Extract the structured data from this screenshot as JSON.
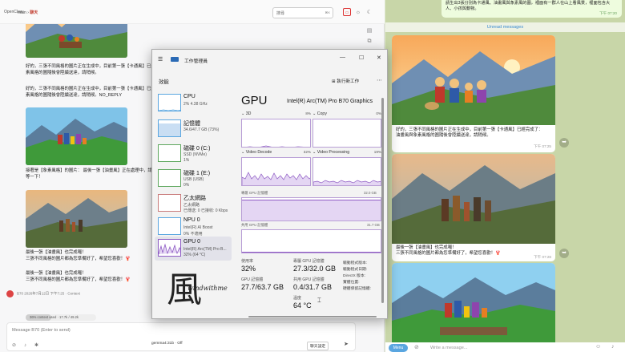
{
  "openclaw": {
    "brand": "OpenClaw",
    "breadcrumb": {
      "main": "main",
      "current": "聊天"
    },
    "search": {
      "placeholder": "搜尋",
      "shortcut": "⌘K"
    },
    "messages": [
      {
        "text": "好的，三張不同風格的圖片正在生成中，目前第一張【卡通風】已生成，油畫風與象素風格的圖隨後會陸續送達，請稍候。"
      },
      {
        "text": "好的，三張不同風格的圖片正在生成中，目前第一張【卡通風】已生成，油畫風與象素風格的圖隨後會陸續送達，請稍候。NO_REPLY"
      },
      {
        "text": "接著是【象素風格】的圖片：\n最後一張【油畫風】正在處理中，請再稍等一下！"
      },
      {
        "text": "最後一張【油畫風】也完成囉！\n三張不同風格的圖片都為您準備好了，希望您喜歡！🦞"
      },
      {
        "text": "最後一張【油畫風】也完成囉！\n三張不同風格的圖片都為您準備好了，希望您喜歡！🦞"
      }
    ],
    "meta": {
      "author": "B70",
      "timestamp": "2026年7月12日 下午7:25",
      "context_label": "Context"
    },
    "context": {
      "label": "36% context used",
      "tokens": "17.7k / 49.2k",
      "fraction": 0.36
    },
    "composer": {
      "placeholder": "Message B70 (Enter to send)",
      "model": "gemma4:31b · Off",
      "voice": "聊天設定"
    }
  },
  "telegram": {
    "top_bubble": {
      "text": "請生出3張分別為卡通風、油畫風與象素風的圖，裡面有一群人在山上看風景，裡面包含大人、小孩與動物。",
      "time": "下午 07:20"
    },
    "unread": "Unread messages",
    "messages": [
      {
        "text": "好的，三張不同風格的圖片正在生成中，目前第一張【卡通風】已經完成了：\n油畫風與象素風格的圖隨後會陸續送達，請稍候。",
        "time": "下午 07:25"
      },
      {
        "text": "最後一張【油畫風】也完成囉！\n三張不同風格的圖片都為您準備好了，希望您喜歡！🦞",
        "time": "下午 07:28"
      }
    ],
    "input": {
      "menu": "Menu",
      "placeholder": "Write a message..."
    }
  },
  "taskmgr": {
    "title": "工作管理員",
    "section": "效能",
    "run_task": "執行新工作",
    "sidebar": [
      {
        "name": "CPU",
        "s1": "2% 4.38 GHz",
        "s2": ""
      },
      {
        "name": "記憶體",
        "s1": "34.6/47.7 GB (73%)",
        "s2": ""
      },
      {
        "name": "磁碟 0 (C:)",
        "s1": "SSD (NVMe)",
        "s2": "1%"
      },
      {
        "name": "磁碟 1 (E:)",
        "s1": "USB (USB)",
        "s2": "0%"
      },
      {
        "name": "乙太網路",
        "s1": "乙太網路",
        "s2": "已傳送: 0 已接收: 0 Kbps"
      },
      {
        "name": "NPU 0",
        "s1": "Intel(R) AI Boost",
        "s2": "0% 不適用"
      },
      {
        "name": "GPU 0",
        "s1": "Intel(R) Arc(TM) Pro B...",
        "s2": "32% (64 °C)"
      }
    ],
    "gpu": {
      "heading": "GPU",
      "name": "Intel(R) Arc(TM) Pro B70 Graphics",
      "graphs": [
        {
          "label": "3D",
          "pct": "8%"
        },
        {
          "label": "Copy",
          "pct": "0%"
        },
        {
          "label": "Video Decode",
          "pct": "32%"
        },
        {
          "label": "Video Processing",
          "pct": "19%"
        }
      ],
      "dedicated_label": "專屬 GPU 記憶體",
      "dedicated_max": "32.0 GB",
      "shared_label": "共用 GPU 記憶體",
      "shared_max": "31.7 GB",
      "stats": {
        "util_label": "使用率",
        "util": "32%",
        "ded_label": "專屬 GPU 記憶體",
        "ded": "27.3/32.0 GB",
        "gpu_mem_label": "GPU 記憶體",
        "gpu_mem": "27.7/63.7 GB",
        "shared_label": "共用 GPU 記憶體",
        "shared": "0.4/31.7 GB",
        "temp_label": "溫度",
        "temp": "64 °C"
      },
      "details": [
        "驅動程式版本:",
        "驅動程式日期:",
        "DirectX 版本:",
        "實體位置:",
        "硬體保留記憶體:"
      ]
    },
    "signature": "windwithme",
    "signature_glyph": "風"
  },
  "colors": {
    "gpu_purple": "#8e5bc4",
    "telegram_bg": "#c8d6a8",
    "accent_red": "#c0392b"
  }
}
